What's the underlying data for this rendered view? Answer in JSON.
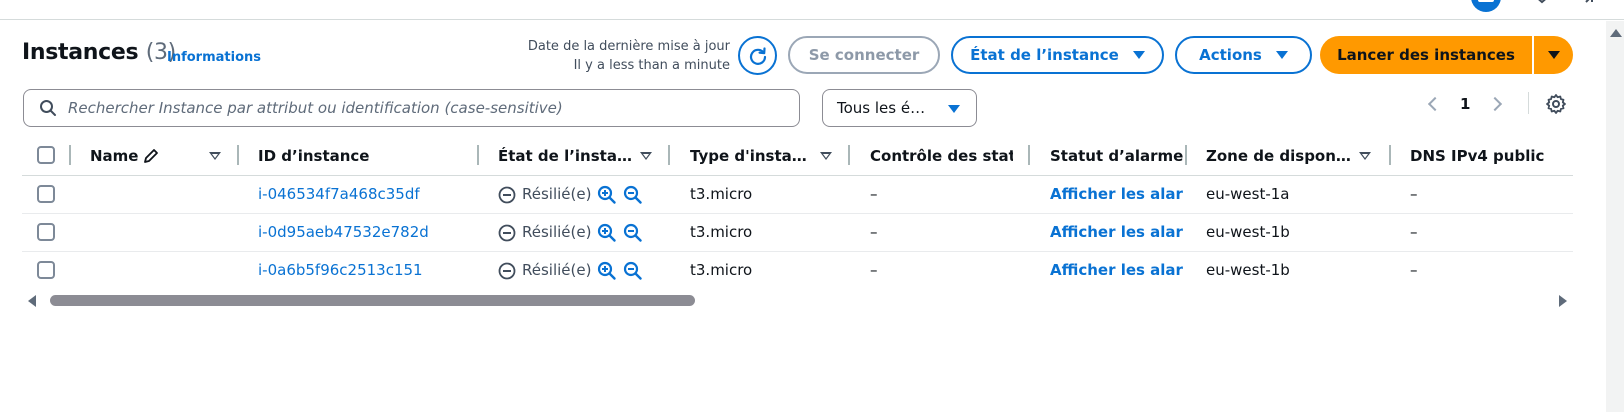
{
  "header": {
    "title": "Instances",
    "count": "(3)",
    "info_link": "Informations",
    "last_update_label": "Date de la dernière mise à jour",
    "last_update_value": "Il y a less than a minute"
  },
  "toolbar": {
    "connect_label": "Se connecter",
    "instance_state_label": "État de l’instance",
    "actions_label": "Actions",
    "launch_label": "Lancer des instances"
  },
  "filters": {
    "search_placeholder": "Rechercher Instance par attribut ou identification (case-sensitive)",
    "state_filter_value": "Tous les é…"
  },
  "pagination": {
    "current_page": "1"
  },
  "table": {
    "columns": [
      "Name",
      "ID d’instance",
      "État de l’insta…",
      "Type d'insta…",
      "Contrôle des statu",
      "Statut d’alarme",
      "Zone de dispon…",
      "DNS IPv4 public"
    ],
    "rows": [
      {
        "name": "",
        "instance_id": "i-046534f7a468c35df",
        "state": "Résilié(e)",
        "type": "t3.micro",
        "status_check": "–",
        "alarm_status": "Afficher les alarm",
        "zone": "eu-west-1a",
        "dns": "–"
      },
      {
        "name": "",
        "instance_id": "i-0d95aeb47532e782d",
        "state": "Résilié(e)",
        "type": "t3.micro",
        "status_check": "–",
        "alarm_status": "Afficher les alarm",
        "zone": "eu-west-1b",
        "dns": "–"
      },
      {
        "name": "",
        "instance_id": "i-0a6b5f96c2513c151",
        "state": "Résilié(e)",
        "type": "t3.micro",
        "status_check": "–",
        "alarm_status": "Afficher les alarm",
        "zone": "eu-west-1b",
        "dns": "–"
      }
    ]
  },
  "colors": {
    "link": "#0972d3",
    "primary": "#ff9900",
    "disabled": "#9ba7b6"
  },
  "icons": [
    "refresh-icon",
    "search-icon",
    "caret-down-icon",
    "settings-gear-icon",
    "chevron-left-icon",
    "chevron-right-icon",
    "pencil-icon",
    "minus-circle-icon",
    "zoom-in-icon",
    "zoom-out-icon"
  ]
}
